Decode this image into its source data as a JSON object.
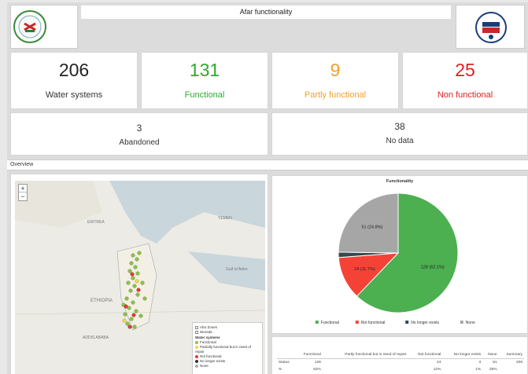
{
  "header": {
    "title": "Afar functionality"
  },
  "cards": [
    {
      "value": "206",
      "label": "Water systems",
      "color": "#222222"
    },
    {
      "value": "131",
      "label": "Functional",
      "color": "#2eaa2e"
    },
    {
      "value": "9",
      "label": "Partly functional",
      "color": "#f0a030"
    },
    {
      "value": "25",
      "label": "Non functional",
      "color": "#e02020"
    }
  ],
  "cards2": [
    {
      "value": "3",
      "label": "Abandoned"
    },
    {
      "value": "38",
      "label": "No data"
    }
  ],
  "overview_label": "Overview",
  "map": {
    "zoom_in": "+",
    "zoom_out": "−",
    "labels": {
      "eritrea": "ERITREA",
      "yemen": "YEMEN",
      "ethiopia": "ETHIOPIA",
      "addis": "ADDIS ABABA",
      "gulf": "Gulf of Aden"
    },
    "legend": {
      "layer1": "Afar Zones",
      "layer2": "Woreda",
      "heading": "Water systems",
      "items": [
        {
          "label": "Functional",
          "color": "#8bc34a"
        },
        {
          "label": "Partially functional but in need of repair",
          "color": "#f6d743"
        },
        {
          "label": "Not functional",
          "color": "#e53935"
        },
        {
          "label": "No longer exists",
          "color": "#333333"
        },
        {
          "label": "None",
          "color": "#aaaaaa"
        }
      ]
    }
  },
  "chart_data": {
    "type": "pie",
    "title": "Functionality",
    "series": [
      {
        "name": "Functional",
        "value": 128,
        "label": "128 (62.1%)",
        "color": "#4caf50"
      },
      {
        "name": "Not functional",
        "value": 24,
        "label": "24 (11.7%)",
        "color": "#f44336"
      },
      {
        "name": "No longer exists",
        "value": 3,
        "label": "",
        "color": "#37474f"
      },
      {
        "name": "None",
        "value": 51,
        "label": "51 (24.8%)",
        "color": "#a6a6a6"
      }
    ],
    "legend_position": "bottom"
  },
  "summary_table": {
    "columns": [
      "",
      "Functional",
      "Partly functional but in need of repair",
      "Not functional",
      "No longer exists",
      "None",
      "Summary"
    ],
    "rows": [
      [
        "Status",
        "128",
        "",
        "24",
        "3",
        "51",
        "206"
      ],
      [
        "%",
        "62%",
        "",
        "12%",
        "1%",
        "25%",
        ""
      ]
    ]
  }
}
